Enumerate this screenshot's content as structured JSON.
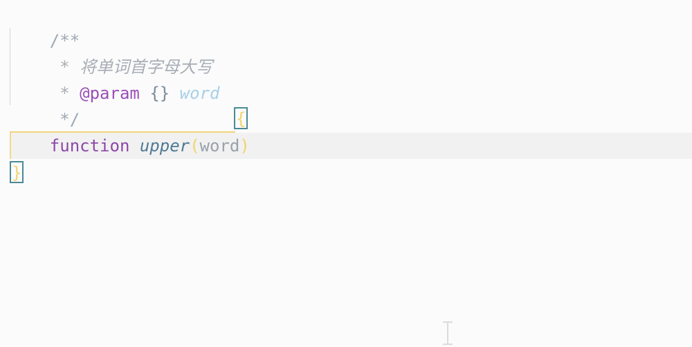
{
  "code": {
    "comment_open": "/**",
    "doc_star_1": " * ",
    "doc_description": "将单词首字母大写",
    "doc_star_2": " * ",
    "doc_tag": "@param",
    "doc_type": "{}",
    "doc_param": "word",
    "comment_close": " */",
    "keyword_function": "function",
    "function_name": "upper",
    "paren_open": "(",
    "parameter": "word",
    "paren_close": ")",
    "brace_open": "{",
    "brace_close": "}"
  },
  "colors": {
    "background": "#fbfbfb",
    "current_line": "#f1f1f1",
    "keyword": "#8d47a8",
    "function_name": "#4f7a93",
    "bracket_highlight": "#4a8994",
    "paren": "#f0d46c"
  },
  "icons": {
    "cursor": "text-cursor-icon"
  }
}
